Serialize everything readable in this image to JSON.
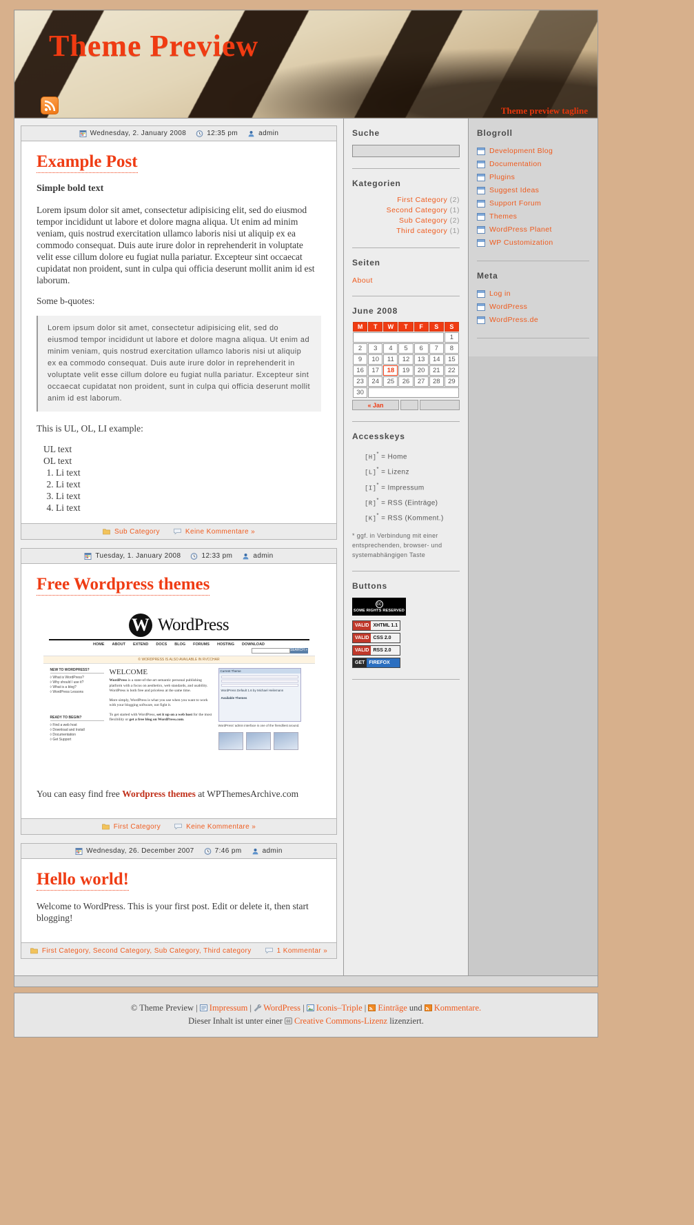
{
  "header": {
    "title": "Theme Preview",
    "tagline": "Theme preview tagline",
    "rss_icon": "rss-icon"
  },
  "posts": [
    {
      "date": "Wednesday, 2. January 2008",
      "time": "12:35 pm",
      "author": "admin",
      "title": "Example Post",
      "bold_line": "Simple bold text",
      "paragraph": "Lorem ipsum dolor sit amet, consectetur adipisicing elit, sed do eiusmod tempor incididunt ut labore et dolore magna aliqua. Ut enim ad minim veniam, quis nostrud exercitation ullamco laboris nisi ut aliquip ex ea commodo consequat. Duis aute irure dolor in reprehenderit in voluptate velit esse cillum dolore eu fugiat nulla pariatur. Excepteur sint occaecat cupidatat non proident, sunt in culpa qui officia deserunt mollit anim id est laborum.",
      "quote_intro": "Some b-quotes:",
      "blockquote": "Lorem ipsum dolor sit amet, consectetur adipisicing elit, sed do eiusmod tempor incididunt ut labore et dolore magna aliqua. Ut enim ad minim veniam, quis nostrud exercitation ullamco laboris nisi ut aliquip ex ea commodo consequat. Duis aute irure dolor in reprehenderit in voluptate velit esse cillum dolore eu fugiat nulla pariatur. Excepteur sint occaecat cupidatat non proident, sunt in culpa qui officia deserunt mollit anim id est laborum.",
      "list_intro": "This is UL, OL, LI example:",
      "ul_items": [
        "UL text",
        "OL text"
      ],
      "ol_items": [
        "Li text",
        "Li text",
        "Li text",
        "Li text"
      ],
      "categories": "Sub Category",
      "comments": "Keine Kommentare »"
    },
    {
      "date": "Tuesday, 1. January 2008",
      "time": "12:33 pm",
      "author": "admin",
      "title": "Free Wordpress themes",
      "closing_pre": "You can easy find free ",
      "closing_bold": "Wordpress themes",
      "closing_post": " at WPThemesArchive.com",
      "categories": "First Category",
      "comments": "Keine Kommentare »"
    },
    {
      "date": "Wednesday, 26. December 2007",
      "time": "7:46 pm",
      "author": "admin",
      "title": "Hello world!",
      "paragraph": "Welcome to WordPress. This is your first post. Edit or delete it, then start blogging!",
      "categories": "First Category, Second Category, Sub Category, Third category",
      "comments": "1 Kommentar »"
    }
  ],
  "wp_screenshot": {
    "brand": "WordPress",
    "brand_mark": "W",
    "nav": [
      "HOME",
      "ABOUT",
      "EXTEND",
      "DOCS",
      "BLOG",
      "FORUMS",
      "HOSTING",
      "DOWNLOAD"
    ],
    "search_button": "SEARCH »",
    "band": "© WORDPRESS IS ALSO AVAILABLE IN RVCCHAR",
    "welcome": "WELCOME",
    "col1_h1": "NEW TO WORDPRESS?",
    "col1_items": [
      "◊ What is WordPress?",
      "◊ Why should I use it?",
      "◊ What is a blog?",
      "◊ WordPress Lessons"
    ],
    "col1_h2": "READY TO BEGIN?",
    "col1_items2": [
      "◊ Find a web host",
      "◊ Download and Install",
      "◊ Documentation",
      "◊ Get Support"
    ],
    "para1_bold": "WordPress",
    "para1": " is a state-of-the-art semantic personal publishing platform with a focus on aesthetics, web standards, and usability. WordPress is both free and priceless at the same time.",
    "para2": "More simply, WordPress is what you use when you want to work with your blogging software, not fight it.",
    "para3_pre": "To get started with WordPress, ",
    "para3_b1": "set it up on a web host",
    "para3_mid": " for the most flexibility or ",
    "para3_b2": "get a free blog on WordPress.com",
    "para3_end": ".",
    "panel_title": "Current Theme",
    "panel_sub": "WordPress Default 1.6 by Michael Heilemann",
    "panel_h2": "Available Themes",
    "caption": "WordPress' admin interface is one of the friendliest around."
  },
  "sidebar": {
    "search": {
      "heading": "Suche",
      "value": "",
      "placeholder": ""
    },
    "categories": {
      "heading": "Kategorien",
      "items": [
        {
          "label": "First Category",
          "count": "(2)"
        },
        {
          "label": "Second Category",
          "count": "(1)"
        },
        {
          "label": "Sub Category",
          "count": "(2)"
        },
        {
          "label": "Third category",
          "count": "(1)"
        }
      ]
    },
    "pages": {
      "heading": "Seiten",
      "items": [
        "About"
      ]
    },
    "calendar": {
      "title": "June 2008",
      "weekdays": [
        "M",
        "T",
        "W",
        "T",
        "F",
        "S",
        "S"
      ],
      "weeks": [
        [
          "",
          "",
          "",
          "",
          "",
          "",
          "1"
        ],
        [
          "2",
          "3",
          "4",
          "5",
          "6",
          "7",
          "8"
        ],
        [
          "9",
          "10",
          "11",
          "12",
          "13",
          "14",
          "15"
        ],
        [
          "16",
          "17",
          "18",
          "19",
          "20",
          "21",
          "22"
        ],
        [
          "23",
          "24",
          "25",
          "26",
          "27",
          "28",
          "29"
        ],
        [
          "30",
          "",
          "",
          "",
          "",
          "",
          ""
        ]
      ],
      "today": "18",
      "prev_label": "« Jan"
    },
    "accesskeys": {
      "heading": "Accesskeys",
      "items": [
        {
          "key": "[H]",
          "sup": "*",
          "eq": "=",
          "label": "Home"
        },
        {
          "key": "[L]",
          "sup": "*",
          "eq": "=",
          "label": "Lizenz"
        },
        {
          "key": "[I]",
          "sup": "*",
          "eq": "=",
          "label": "Impressum"
        },
        {
          "key": "[R]",
          "sup": "*",
          "eq": "=",
          "label": "RSS (Einträge)"
        },
        {
          "key": "[K]",
          "sup": "*",
          "eq": "=",
          "label": "RSS (Komment.)"
        }
      ],
      "note": "* ggf. in Verbindung mit einer entsprechenden, browser- und systemabhängigen Taste"
    },
    "buttons": {
      "heading": "Buttons",
      "cc_symbol": "cc",
      "cc_text": "SOME RIGHTS RESERVED",
      "badges": [
        {
          "left": "VALID",
          "right": "XHTML 1.1"
        },
        {
          "left": "VALID",
          "right": "CSS 2.0"
        },
        {
          "left": "VALID",
          "right": "RSS 2.0"
        },
        {
          "left": "GET",
          "right": "FIREFOX"
        }
      ]
    }
  },
  "sidebar2": {
    "blogroll": {
      "heading": "Blogroll",
      "items": [
        "Development Blog",
        "Documentation",
        "Plugins",
        "Suggest Ideas",
        "Support Forum",
        "Themes",
        "WordPress Planet",
        "WP Customization"
      ]
    },
    "meta": {
      "heading": "Meta",
      "items": [
        "Log in",
        "WordPress",
        "WordPress.de"
      ]
    }
  },
  "footer": {
    "copyright": "© Theme Preview",
    "sep": "|",
    "impressum": "Impressum",
    "wordpress": "WordPress",
    "iconis": "Iconis–Triple",
    "entries": "Einträge",
    "und": "und",
    "comments": "Kommentare.",
    "line2_pre": "Dieser Inhalt ist unter einer",
    "license": "Creative Commons-Lizenz",
    "line2_post": "lizenziert."
  },
  "colors": {
    "accent": "#ef3c14",
    "link": "#ef5b1e",
    "page_bg": "#d7b08c",
    "calendar_header": "#f03b12"
  }
}
